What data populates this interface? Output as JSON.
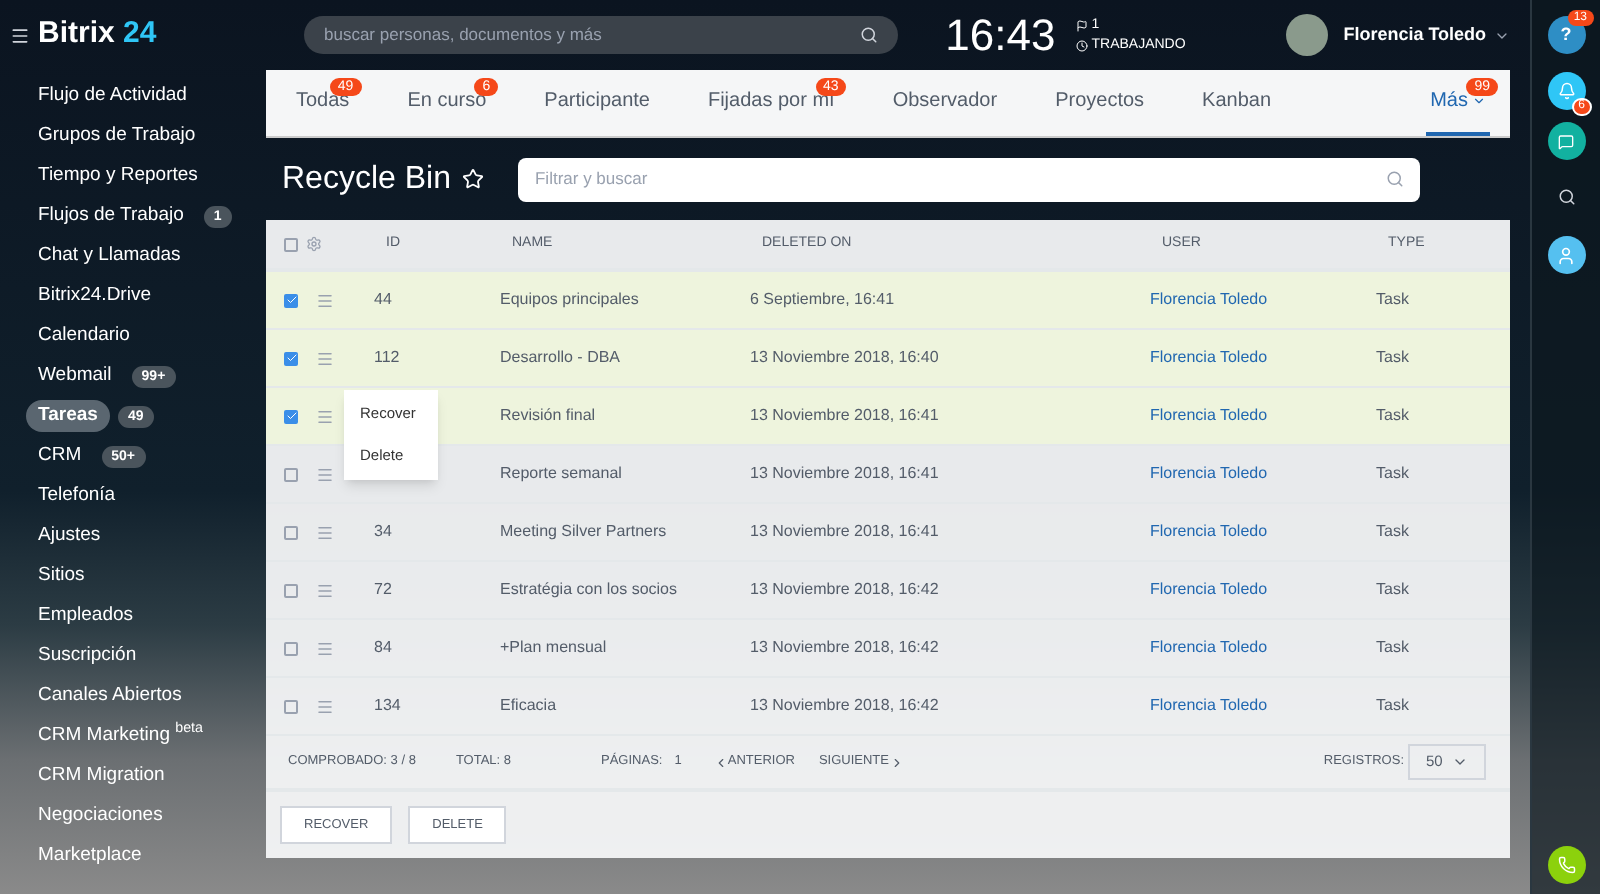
{
  "header": {
    "logo_word": "Bitrix",
    "logo_number": "24",
    "search": {
      "placeholder": "buscar personas, documentos y más"
    },
    "time": "16:43",
    "flag_count": "1",
    "status": "TRABAJANDO",
    "user_name": "Florencia Toledo"
  },
  "sidebar": {
    "items": [
      {
        "label": "Flujo de Actividad",
        "selected": false
      },
      {
        "label": "Grupos de Trabajo",
        "selected": false
      },
      {
        "label": "Tiempo y Reportes",
        "selected": false
      },
      {
        "label": "Flujos de Trabajo",
        "selected": false,
        "counter": "1"
      },
      {
        "label": "Chat y Llamadas",
        "selected": false
      },
      {
        "label": "Bitrix24.Drive",
        "selected": false
      },
      {
        "label": "Calendario",
        "selected": false
      },
      {
        "label": "Webmail",
        "selected": false,
        "counter": "99+"
      },
      {
        "label": "Tareas",
        "selected": true,
        "counter": "49"
      },
      {
        "label": "CRM",
        "selected": false,
        "counter": "50+"
      },
      {
        "label": "Telefonía",
        "selected": false
      },
      {
        "label": "Ajustes",
        "selected": false
      },
      {
        "label": "Sitios",
        "selected": false
      },
      {
        "label": "Empleados",
        "selected": false
      },
      {
        "label": "Suscripción",
        "selected": false
      },
      {
        "label": "Canales Abiertos",
        "selected": false
      },
      {
        "label": "CRM Marketing $^{beta}$",
        "selected": false
      },
      {
        "label": "CRM Migration",
        "selected": false
      },
      {
        "label": "Negociaciones",
        "selected": false
      },
      {
        "label": "Marketplace",
        "selected": false
      }
    ]
  },
  "tabs": [
    {
      "label": "Todas",
      "selected": false,
      "counter": "49"
    },
    {
      "label": "En curso",
      "selected": false,
      "counter": "6"
    },
    {
      "label": "Participante",
      "selected": false
    },
    {
      "label": "Fijadas por mí",
      "selected": false,
      "counter": "43"
    },
    {
      "label": "Observador",
      "selected": false
    },
    {
      "label": "Proyectos",
      "selected": false
    },
    {
      "label": "Kanban",
      "selected": false
    },
    {
      "label": "Más",
      "selected": true,
      "counter": "99"
    }
  ],
  "page": {
    "title": "Recycle Bin",
    "filter": {
      "placeholder": "Filtrar y buscar"
    }
  },
  "table": {
    "select_all": false,
    "columns": [
      "ID",
      "NAME",
      "DELETED ON",
      "USER",
      "TYPE"
    ],
    "rows": [
      {
        "selected": true,
        "id": "44",
        "name": "Equipos principales",
        "deleted_on": "6 Septiembre, 16:41",
        "user": "Florencia Toledo",
        "type": "Task"
      },
      {
        "selected": true,
        "id": "112",
        "name": "Desarrollo - DBA",
        "deleted_on": "13 Noviembre 2018, 16:40",
        "user": "Florencia Toledo",
        "type": "Task"
      },
      {
        "selected": true,
        "id": "",
        "name": "Revisión final",
        "deleted_on": "13 Noviembre 2018, 16:41",
        "user": "Florencia Toledo",
        "type": "Task"
      },
      {
        "selected": false,
        "id": "",
        "name": "Reporte semanal",
        "deleted_on": "13 Noviembre 2018, 16:41",
        "user": "Florencia Toledo",
        "type": "Task"
      },
      {
        "selected": false,
        "id": "34",
        "name": "Meeting Silver Partners",
        "deleted_on": "13 Noviembre 2018, 16:41",
        "user": "Florencia Toledo",
        "type": "Task"
      },
      {
        "selected": false,
        "id": "72",
        "name": "Estratégia con los socios",
        "deleted_on": "13 Noviembre 2018, 16:42",
        "user": "Florencia Toledo",
        "type": "Task"
      },
      {
        "selected": false,
        "id": "84",
        "name": "+Plan mensual",
        "deleted_on": "13 Noviembre 2018, 16:42",
        "user": "Florencia Toledo",
        "type": "Task"
      },
      {
        "selected": false,
        "id": "134",
        "name": "Eficacia",
        "deleted_on": "13 Noviembre 2018, 16:42",
        "user": "Florencia Toledo",
        "type": "Task"
      }
    ],
    "context_menu": [
      "Recover",
      "Delete"
    ],
    "footer": {
      "checked": "COMPROBADO: 3 / 8",
      "total": "TOTAL: 8",
      "pages": "PÁGINAS:",
      "page_number": "1",
      "prev": "ANTERIOR",
      "next": "SIGUIENTE",
      "records_label": "REGISTROS:",
      "records_value": "50"
    }
  },
  "actions": [
    "RECOVER",
    "DELETE"
  ],
  "right_rail": {
    "help_label": "?",
    "help_counter": "13",
    "bell_counter": "6"
  }
}
